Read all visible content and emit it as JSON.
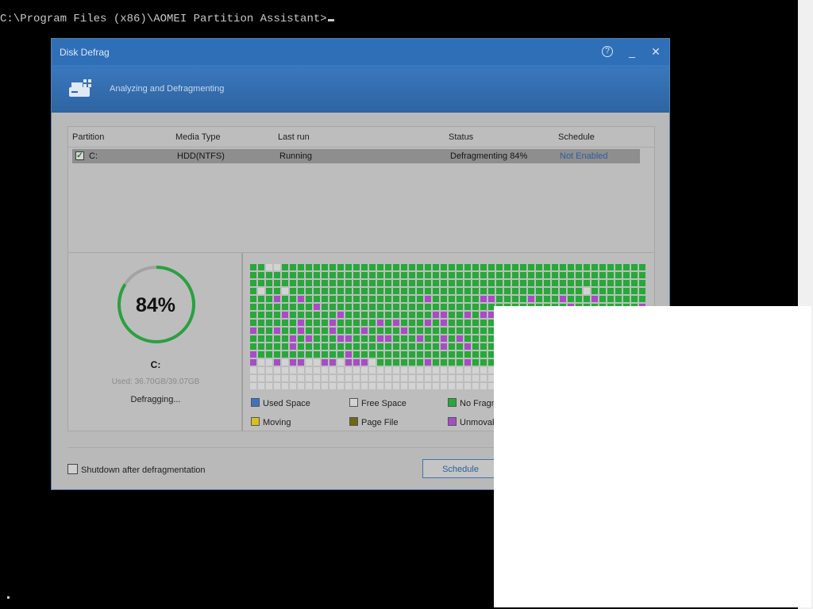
{
  "console": {
    "prompt": "C:\\Program Files (x86)\\AOMEI Partition Assistant>"
  },
  "dialog": {
    "title": "Disk Defrag",
    "help_glyph": "?",
    "minimize_glyph": "_",
    "close_glyph": "✕",
    "subtitle": "Analyzing and Defragmenting"
  },
  "table": {
    "headers": [
      "Partition",
      "Media Type",
      "Last run",
      "Status",
      "Schedule"
    ],
    "rows": [
      {
        "partition": "C:",
        "media_type": "HDD(NTFS)",
        "last_run": "Running",
        "status": "Defragmenting 84%",
        "schedule": "Not Enabled",
        "checked": true
      }
    ]
  },
  "progress": {
    "percent_label": "84%",
    "fraction": 0.84,
    "drive": "C:",
    "used": "Used: 36.70GB/39.07GB",
    "state": "Defragging..."
  },
  "legend": [
    {
      "label": "Used Space",
      "color": "#3f73c2"
    },
    {
      "label": "Free Space",
      "color": "#d3d3d3"
    },
    {
      "label": "No Fragm",
      "color": "#27a83a"
    },
    {
      "label": "Moving",
      "color": "#d6c11d"
    },
    {
      "label": "Page File",
      "color": "#6b6b13"
    },
    {
      "label": "Unmovab",
      "color": "#a54ec4"
    }
  ],
  "colors": {
    "accent": "#2f6fb8",
    "ring_track": "#a3a3a3",
    "ring_fill": "#2aa040"
  },
  "footer": {
    "shutdown_label": "Shutdown after defragmentation",
    "schedule_button": "Schedule"
  }
}
